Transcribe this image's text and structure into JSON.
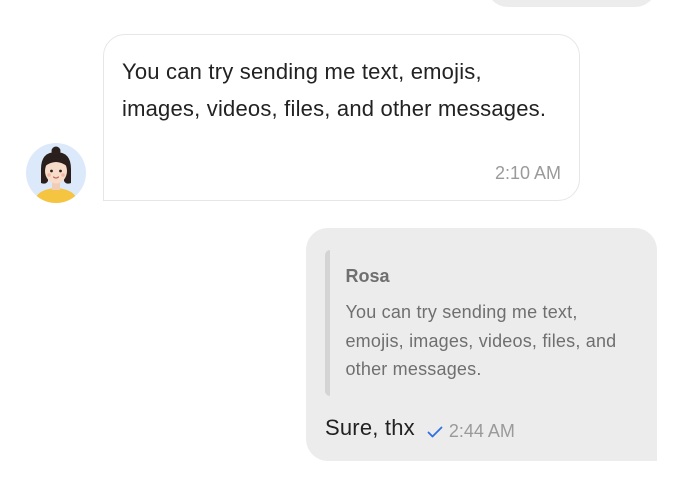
{
  "incoming": {
    "text": "You can try sending me text, emojis, images, videos, files, and other messages.",
    "time": "2:10 AM",
    "avatar_icon": "user-avatar-icon"
  },
  "outgoing": {
    "quote_author": "Rosa",
    "quote_text": "You can try sending me text, emojis, images, videos, files, and other messages.",
    "text": "Sure, thx",
    "time": "2:44 AM",
    "status_icon": "sent-check-icon"
  },
  "colors": {
    "outgoing_bubble": "#ececec",
    "check_accent": "#2f6fe4",
    "avatar_bg": "#dce9fb"
  }
}
